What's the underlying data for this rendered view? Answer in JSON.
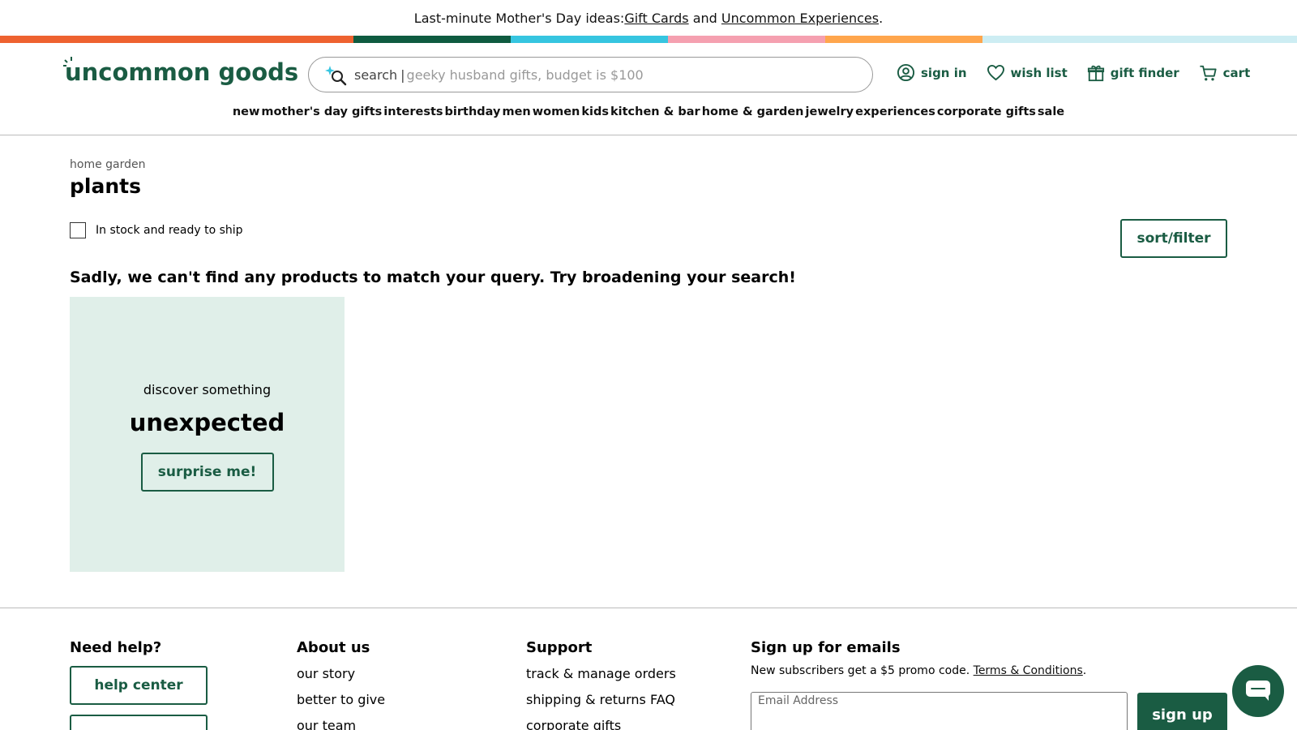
{
  "promo": {
    "lead": "Last-minute Mother's Day ideas: ",
    "link1": "Gift Cards",
    "mid": " and ",
    "link2": "Uncommon Experiences",
    "end": "."
  },
  "colors": {
    "brand": "#1a5c43",
    "stripe": [
      "#ee6230",
      "#0f5b40",
      "#36c5e0",
      "#f5a0b0",
      "#ffa64d",
      "#cdedf3"
    ]
  },
  "header": {
    "logo_text": "uncommon goods",
    "search": {
      "label": "search",
      "placeholder": "geeky husband gifts, budget is $100",
      "icon": "sparkle-search-icon"
    },
    "actions": [
      {
        "label": "sign in",
        "icon": "user-circle-icon"
      },
      {
        "label": "wish list",
        "icon": "heart-icon"
      },
      {
        "label": "gift finder",
        "icon": "gift-icon"
      },
      {
        "label": "cart",
        "icon": "cart-icon"
      }
    ],
    "nav": [
      "new",
      "mother's day gifts",
      "interests",
      "birthday",
      "men",
      "women",
      "kids",
      "kitchen & bar",
      "home & garden",
      "jewelry",
      "experiences",
      "corporate gifts",
      "sale"
    ]
  },
  "main": {
    "breadcrumb": "home garden",
    "title": "plants",
    "filter_label": "In stock and ready to ship",
    "sort_button": "sort/filter",
    "empty_message": "Sadly, we can't find any products to match your query. Try broadening your search!",
    "promo_card": {
      "small": "discover something",
      "big": "unexpected",
      "button": "surprise me!"
    }
  },
  "footer": {
    "help": {
      "title": "Need help?",
      "button": "help center"
    },
    "about": {
      "title": "About us",
      "links": [
        "our story",
        "better to give",
        "our team"
      ]
    },
    "support": {
      "title": "Support",
      "links": [
        "track & manage orders",
        "shipping & returns FAQ",
        "corporate gifts"
      ]
    },
    "emails": {
      "title": "Sign up for emails",
      "desc": "New subscribers get a $5 promo code. ",
      "terms": "Terms & Conditions",
      "desc_end": ".",
      "placeholder": "Email Address",
      "button": "sign up"
    }
  }
}
